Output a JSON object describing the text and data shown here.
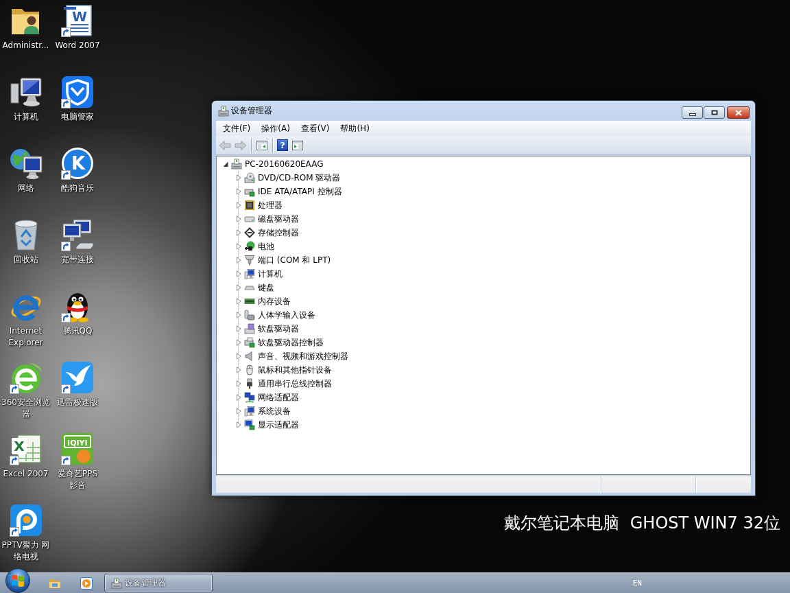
{
  "desktop": {
    "icons": [
      {
        "label": "Administr...",
        "kind": "user-folder",
        "shortcut": false
      },
      {
        "label": "计算机",
        "kind": "computer",
        "shortcut": false
      },
      {
        "label": "网络",
        "kind": "network",
        "shortcut": false
      },
      {
        "label": "回收站",
        "kind": "recycle-bin",
        "shortcut": false
      },
      {
        "label": "Internet Explorer",
        "kind": "ie",
        "shortcut": false
      },
      {
        "label": "360安全浏览器",
        "kind": "green-browser",
        "shortcut": true
      },
      {
        "label": "Excel 2007",
        "kind": "excel",
        "shortcut": true,
        "logo_text": "X"
      },
      {
        "label": "PPTV聚力 网络电视",
        "kind": "tv",
        "shortcut": true
      },
      {
        "label": "Word 2007",
        "kind": "word",
        "shortcut": true,
        "logo_text": "W"
      },
      {
        "label": "电脑管家",
        "kind": "shield",
        "shortcut": true
      },
      {
        "label": "酷狗音乐",
        "kind": "music",
        "shortcut": true,
        "logo_text": "K"
      },
      {
        "label": "宽带连接",
        "kind": "broadband",
        "shortcut": true
      },
      {
        "label": "腾讯QQ",
        "kind": "penguin",
        "shortcut": true
      },
      {
        "label": "迅雷极速版",
        "kind": "bird",
        "shortcut": true
      },
      {
        "label": "爱奇艺PPS 影音",
        "kind": "video",
        "shortcut": true,
        "logo_text": "iQIYI"
      }
    ],
    "wallpaper_text": "戴尔笔记本电脑  GHOST WIN7 32位"
  },
  "window": {
    "title": "设备管理器",
    "menu": [
      "文件(F)",
      "操作(A)",
      "查看(V)",
      "帮助(H)"
    ],
    "toolbar": [
      [
        {
          "kind": "back",
          "disabled": true
        },
        {
          "kind": "forward",
          "disabled": true
        }
      ],
      [
        {
          "kind": "tree-pane",
          "disabled": false
        }
      ],
      [
        {
          "kind": "help",
          "disabled": false,
          "glyph": "?"
        },
        {
          "kind": "action-pane",
          "disabled": false
        }
      ]
    ],
    "tree": {
      "label": "PC-20160620EAAG",
      "kind": "pc",
      "expanded": true,
      "children": [
        {
          "label": "DVD/CD-ROM 驱动器",
          "kind": "dvd",
          "expanded": false
        },
        {
          "label": "IDE ATA/ATAPI 控制器",
          "kind": "ide",
          "expanded": false
        },
        {
          "label": "处理器",
          "kind": "cpu",
          "expanded": false
        },
        {
          "label": "磁盘驱动器",
          "kind": "disk",
          "expanded": false
        },
        {
          "label": "存储控制器",
          "kind": "storage",
          "expanded": false
        },
        {
          "label": "电池",
          "kind": "battery",
          "expanded": false
        },
        {
          "label": "端口 (COM 和 LPT)",
          "kind": "port",
          "expanded": false
        },
        {
          "label": "计算机",
          "kind": "computer",
          "expanded": false
        },
        {
          "label": "键盘",
          "kind": "keyboard",
          "expanded": false
        },
        {
          "label": "内存设备",
          "kind": "memory",
          "expanded": false
        },
        {
          "label": "人体学输入设备",
          "kind": "hid",
          "expanded": false
        },
        {
          "label": "软盘驱动器",
          "kind": "floppy",
          "expanded": false
        },
        {
          "label": "软盘驱动器控制器",
          "kind": "floppy-controller",
          "expanded": false
        },
        {
          "label": "声音、视频和游戏控制器",
          "kind": "sound",
          "expanded": false
        },
        {
          "label": "鼠标和其他指针设备",
          "kind": "mouse",
          "expanded": false
        },
        {
          "label": "通用串行总线控制器",
          "kind": "usb",
          "expanded": false
        },
        {
          "label": "网络适配器",
          "kind": "network",
          "expanded": false
        },
        {
          "label": "系统设备",
          "kind": "system",
          "expanded": false
        },
        {
          "label": "显示适配器",
          "kind": "display",
          "expanded": false
        }
      ]
    }
  },
  "taskbar": {
    "pinned": [
      {
        "kind": "folder"
      },
      {
        "kind": "media"
      }
    ],
    "tasks": [
      {
        "label": "设备管理器",
        "kind": "device-manager",
        "selected": true
      }
    ],
    "language": "EN"
  }
}
